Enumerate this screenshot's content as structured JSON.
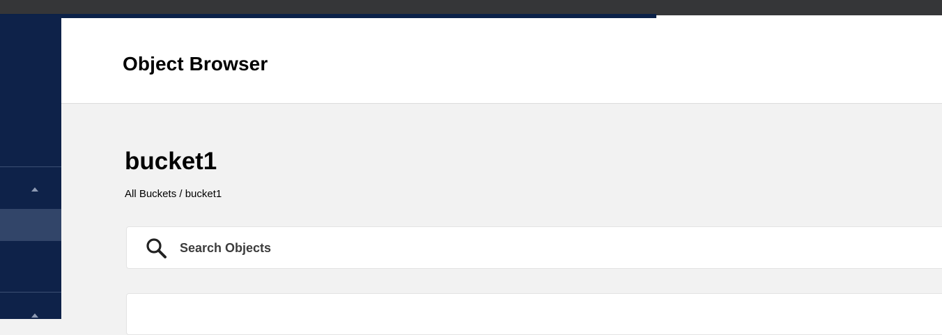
{
  "header": {
    "title": "Object Browser"
  },
  "bucket": {
    "name": "bucket1"
  },
  "breadcrumb": {
    "root": "All Buckets",
    "separator": " / ",
    "current": "bucket1"
  },
  "search": {
    "placeholder": "Search Objects",
    "value": ""
  },
  "sidebar": {
    "sections": [
      {
        "icon": "chevron-up-icon",
        "expanded": true
      },
      {
        "icon": "chevron-up-icon",
        "expanded": true
      }
    ]
  },
  "colors": {
    "sidebar_bg": "#0e2249",
    "sidebar_active": "#324569",
    "content_bg": "#f2f2f2",
    "header_bg": "#ffffff"
  }
}
